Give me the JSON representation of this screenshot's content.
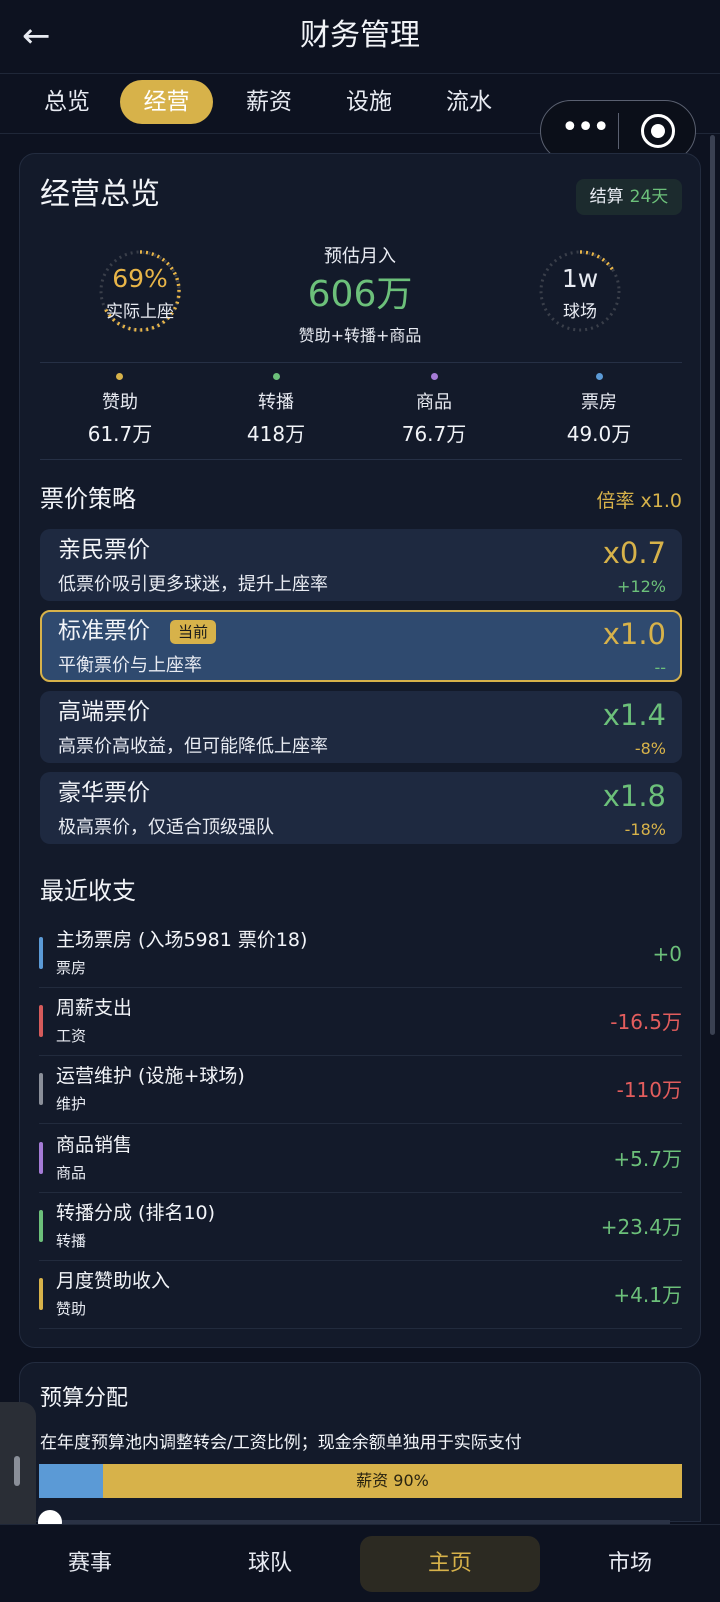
{
  "header": {
    "title": "财务管理",
    "back_icon": "arrow-left-icon"
  },
  "tabs": [
    {
      "label": "总览",
      "active": false
    },
    {
      "label": "经营",
      "active": true
    },
    {
      "label": "薪资",
      "active": false
    },
    {
      "label": "设施",
      "active": false
    },
    {
      "label": "流水",
      "active": false
    }
  ],
  "capsule": {
    "more_icon": "more-dots-icon",
    "close_icon": "target-icon"
  },
  "overview": {
    "title": "经营总览",
    "settle_label": "结算",
    "settle_value": "24天",
    "attendance_pct": "69%",
    "attendance_label": "实际上座",
    "attendance_fraction": 0.69,
    "est_label": "预估月入",
    "est_value": "606万",
    "est_sub": "赞助+转播+商品",
    "venue_value": "1w",
    "venue_label": "球场",
    "sources": [
      {
        "label": "赞助",
        "value": "61.7万",
        "color": "#d7b24a"
      },
      {
        "label": "转播",
        "value": "418万",
        "color": "#6cc07a"
      },
      {
        "label": "商品",
        "value": "76.7万",
        "color": "#a57bd6"
      },
      {
        "label": "票房",
        "value": "49.0万",
        "color": "#5b9ad6"
      }
    ]
  },
  "pricing": {
    "title": "票价策略",
    "multiplier_label": "倍率 x1.0",
    "current_badge": "当前",
    "options": [
      {
        "name": "亲民票价",
        "desc": "低票价吸引更多球迷，提升上座率",
        "mult": "x0.7",
        "delta": "+12%",
        "mult_color": "#d7b24a",
        "delta_color": "#6cc07a"
      },
      {
        "name": "标准票价",
        "desc": "平衡票价与上座率",
        "mult": "x1.0",
        "delta": "--",
        "mult_color": "#d7b24a",
        "delta_color": "#6cc07a"
      },
      {
        "name": "高端票价",
        "desc": "高票价高收益，但可能降低上座率",
        "mult": "x1.4",
        "delta": "-8%",
        "mult_color": "#6cc07a",
        "delta_color": "#d7b24a"
      },
      {
        "name": "豪华票价",
        "desc": "极高票价，仅适合顶级强队",
        "mult": "x1.8",
        "delta": "-18%",
        "mult_color": "#6cc07a",
        "delta_color": "#d7b24a"
      }
    ]
  },
  "recent": {
    "title": "最近收支",
    "items": [
      {
        "name": "主场票房 (入场5981 票价18)",
        "cat": "票房",
        "amount": "+0",
        "bar_color": "#5b9ad6",
        "amt_color": "#6cc07a"
      },
      {
        "name": "周薪支出",
        "cat": "工资",
        "amount": "-16.5万",
        "bar_color": "#d65b5b",
        "amt_color": "#e35d5d"
      },
      {
        "name": "运营维护 (设施+球场)",
        "cat": "维护",
        "amount": "-110万",
        "bar_color": "#8a8f99",
        "amt_color": "#e35d5d"
      },
      {
        "name": "商品销售",
        "cat": "商品",
        "amount": "+5.7万",
        "bar_color": "#a57bd6",
        "amt_color": "#6cc07a"
      },
      {
        "name": "转播分成 (排名10)",
        "cat": "转播",
        "amount": "+23.4万",
        "bar_color": "#6cc07a",
        "amt_color": "#6cc07a"
      },
      {
        "name": "月度赞助收入",
        "cat": "赞助",
        "amount": "+4.1万",
        "bar_color": "#d7b24a",
        "amt_color": "#6cc07a"
      }
    ]
  },
  "budget": {
    "title": "预算分配",
    "desc": "在年度预算池内调整转会/工资比例；现金余额单独用于实际支付",
    "salary_label": "薪资 90%",
    "salary_fraction": 0.9
  },
  "bottom_nav": [
    {
      "label": "赛事",
      "active": false
    },
    {
      "label": "球队",
      "active": false
    },
    {
      "label": "主页",
      "active": true
    },
    {
      "label": "市场",
      "active": false
    }
  ]
}
